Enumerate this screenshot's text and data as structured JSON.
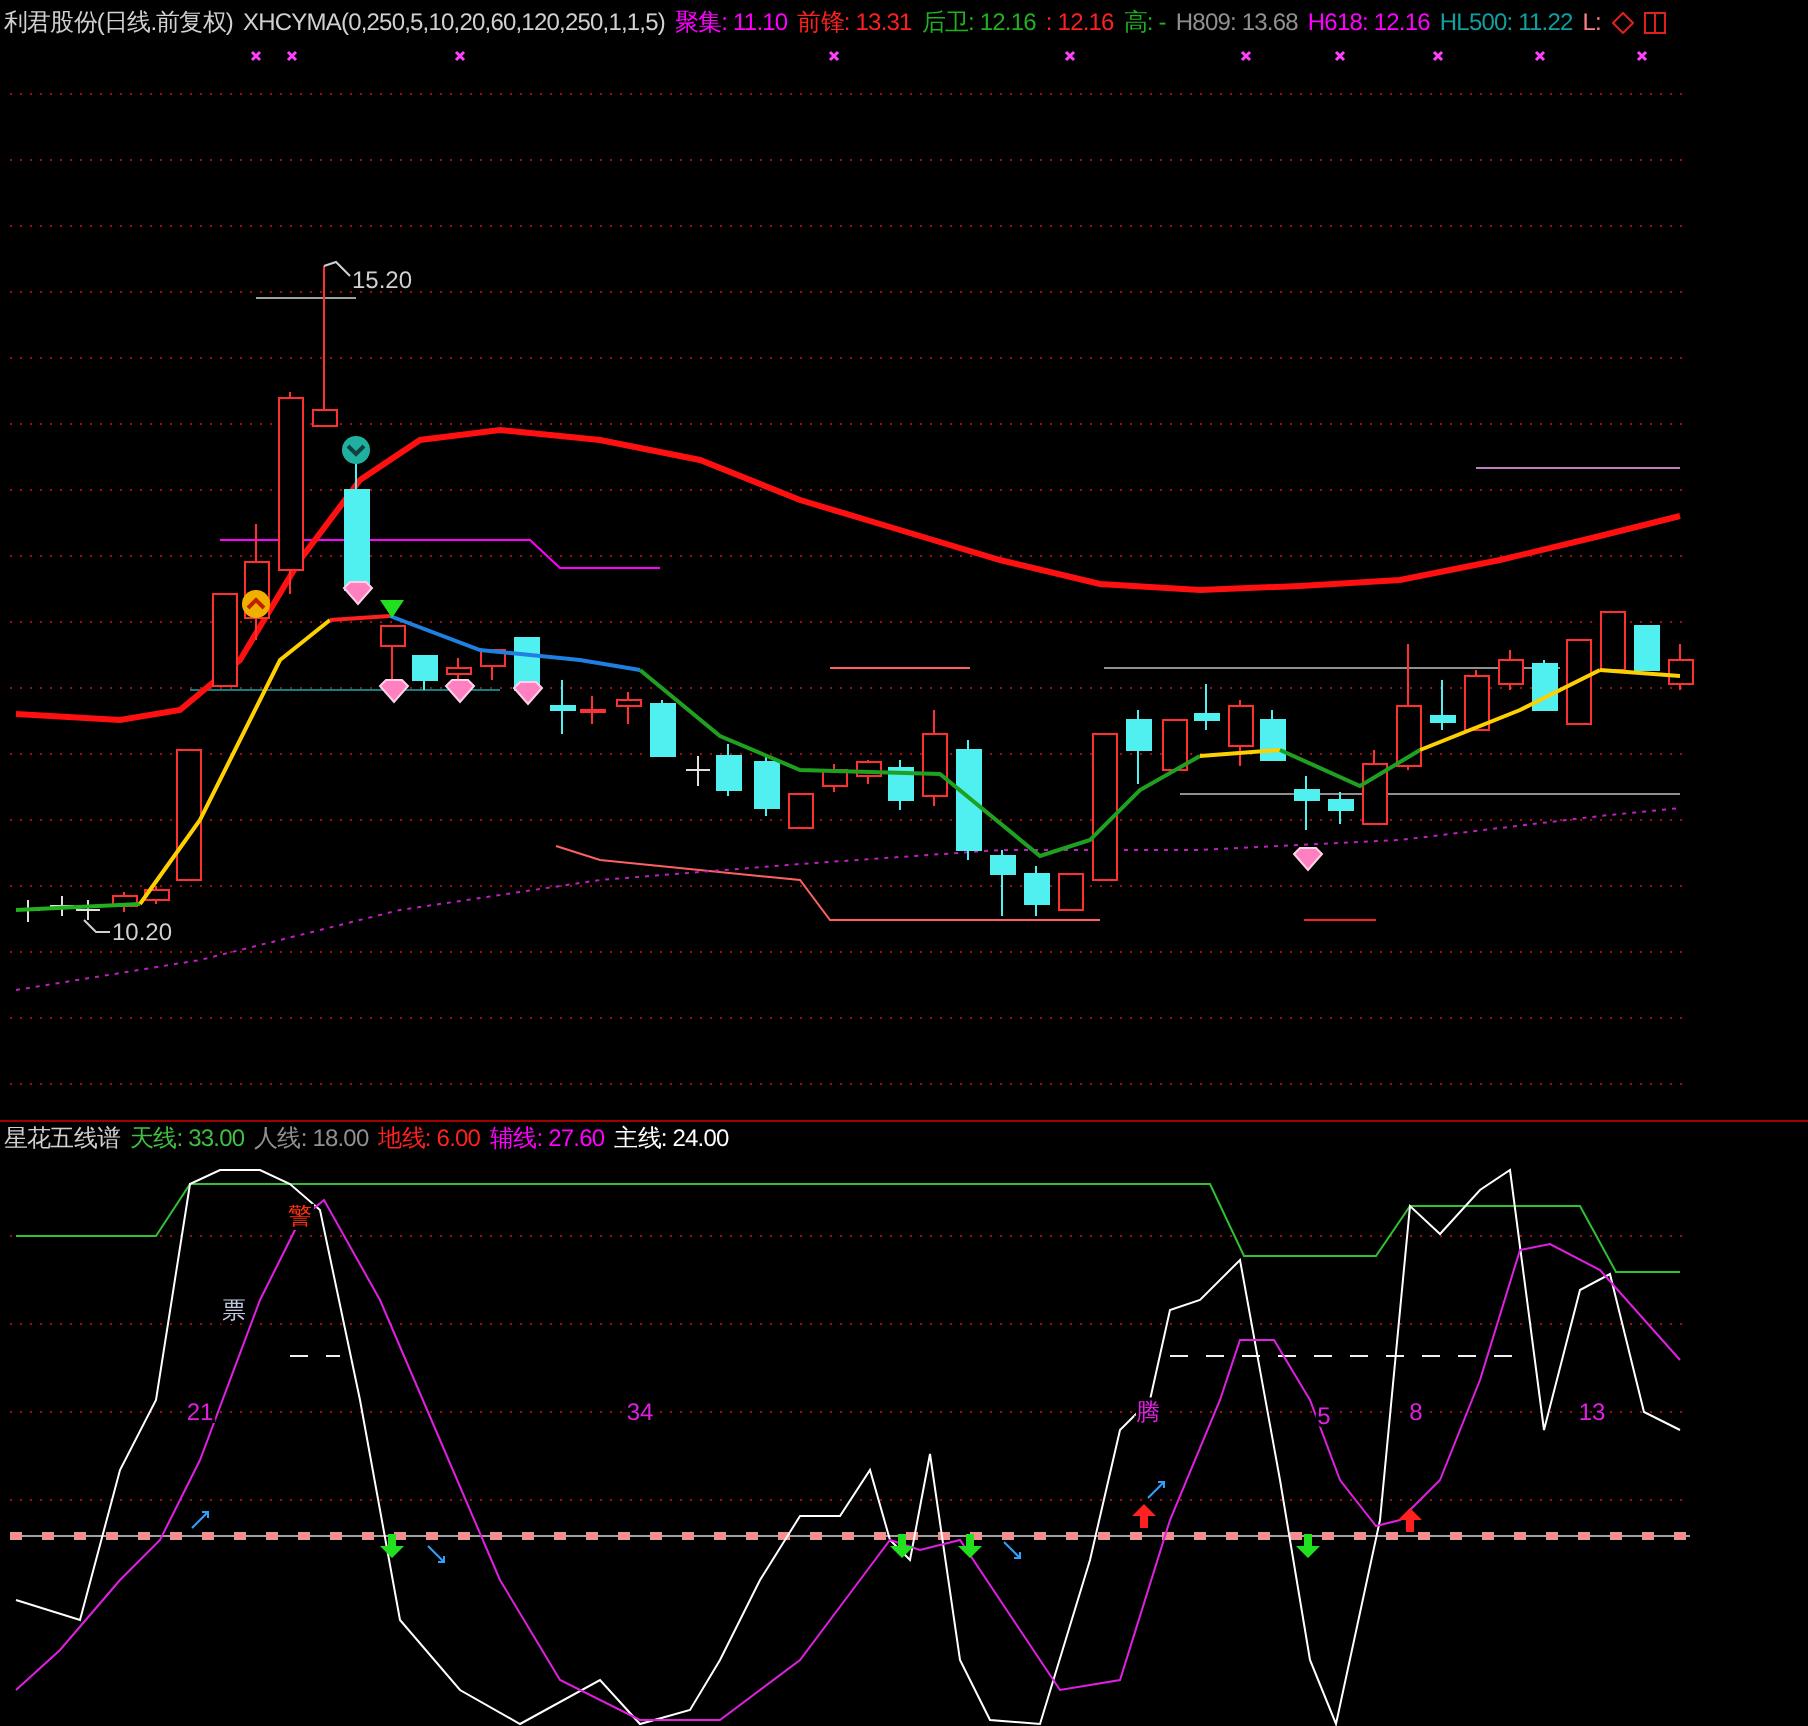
{
  "main_panel": {
    "title": "利君股份(日线.前复权)",
    "indicator": "XHCYMA(0,250,5,10,20,60,120,250,1,1,5)",
    "readouts": [
      {
        "text": "聚集: 11.10",
        "color": "#ff00ff"
      },
      {
        "text": "前锋: 13.31",
        "color": "#ff2020"
      },
      {
        "text": "后卫: 12.16",
        "color": "#20b020"
      },
      {
        "text": ": 12.16",
        "color": "#ff2020"
      },
      {
        "text": "高: -",
        "color": "#20b020"
      },
      {
        "text": "H809: 13.68",
        "color": "#909090"
      },
      {
        "text": "H618: 12.16",
        "color": "#ff00ff"
      },
      {
        "text": "HL500: 11.22",
        "color": "#10a0a0"
      },
      {
        "text": "L:",
        "color": "#ff8080"
      }
    ],
    "price_labels": [
      "15.20",
      "10.20"
    ]
  },
  "sub_panel": {
    "title": "星花五线谱",
    "readouts": [
      {
        "text": "天线: 33.00",
        "color": "#40c040"
      },
      {
        "text": "人线: 18.00",
        "color": "#909090"
      },
      {
        "text": "地线: 6.00",
        "color": "#ff2020"
      },
      {
        "text": "辅线: 27.60",
        "color": "#ff00ff"
      },
      {
        "text": "主线: 24.00",
        "color": "#ffffff"
      }
    ],
    "chart_labels": [
      {
        "text": "警",
        "color": "#ff3010"
      },
      {
        "text": "票",
        "color": "#c0c8e0"
      },
      {
        "text": "21",
        "color": "#e020e0"
      },
      {
        "text": "34",
        "color": "#e020e0"
      },
      {
        "text": "腾",
        "color": "#e020e0"
      },
      {
        "text": "5",
        "color": "#e020e0"
      },
      {
        "text": "8",
        "color": "#e020e0"
      },
      {
        "text": "13",
        "color": "#e020e0"
      }
    ]
  }
}
